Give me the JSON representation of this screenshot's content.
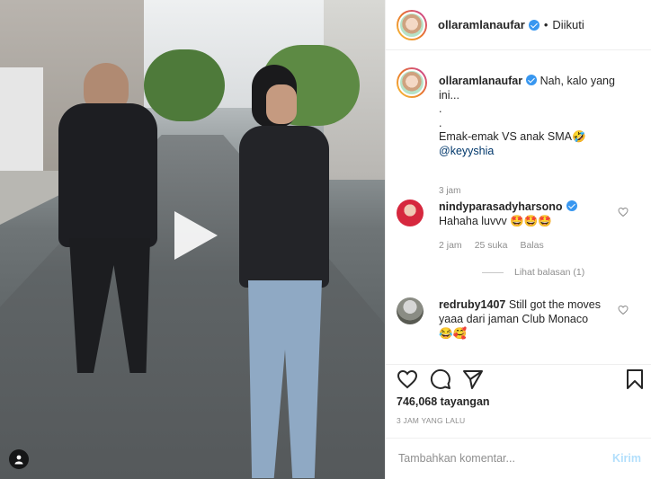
{
  "post": {
    "author": "ollaramlanaufar",
    "follow_status": "Diikuti",
    "separator": "•"
  },
  "caption": {
    "username": "ollaramlanaufar",
    "text_line1": "Nah, kalo yang",
    "text_line2": "ini...",
    "dot1": ".",
    "dot2": ".",
    "line3": "Emak-emak VS anak SMA🤣",
    "mention": "@keyyshia",
    "time": "3 jam"
  },
  "comments": [
    {
      "username": "nindyparasadyharsono",
      "text": "Hahaha luvvv 🤩🤩🤩",
      "time": "2 jam",
      "likes": "25 suka",
      "reply": "Balas",
      "view_replies": "Lihat balasan (1)"
    },
    {
      "username": "redruby1407",
      "text": "Still got the moves yaaa dari jaman Club Monaco",
      "emoji": "😂🥰"
    }
  ],
  "stats": {
    "views": "746,068 tayangan",
    "posted_ago": "3 JAM YANG LALU"
  },
  "composer": {
    "placeholder": "Tambahkan komentar...",
    "post_label": "Kirim"
  },
  "icons": [
    "play-icon",
    "profile-icon",
    "verified-icon",
    "heart-icon",
    "comment-icon",
    "share-icon",
    "bookmark-icon"
  ],
  "colors": {
    "verified": "#3897f0",
    "mention": "#00376b",
    "muted": "#8e8e8e",
    "post_disabled": "#b2dffc"
  }
}
